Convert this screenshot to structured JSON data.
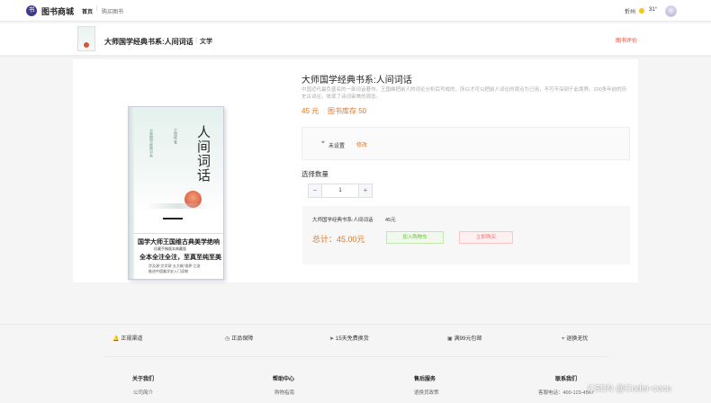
{
  "nav": {
    "logo_char": "书",
    "brand": "图书商城",
    "home": "首页",
    "separator": "|",
    "buy": "购买图书",
    "city": "忻州",
    "temperature": "31°"
  },
  "strip": {
    "title": "大师国学经典书系:人间词话",
    "separator": "|",
    "category": "文学",
    "review_link": "图书评价"
  },
  "cover": {
    "title": "人间词话",
    "side_text": "王国维 著",
    "side_text2": "大师国学经典书系",
    "band_line1": "国学大师王国维古典美学绝响",
    "band_line2": "珍藏手稿版本典藏版",
    "band_line3": "全本全注全注，至真至纯至美",
    "band_line4": "涉及源\"文学观\"五大概\"境界\"之说",
    "band_line5": "推进中国美学史入门读物"
  },
  "product": {
    "title": "大师国学经典书系:人间词话",
    "description": "中国近代最负盛名的一部词话著作。王国维把前人的词论分析后写成的，所以才可以把前人词论的观点为己用，不可不深刻于此境界。200多年前的历史古词论，体现了诗词审美的观念。",
    "price": "45 元",
    "stock": "图书库存 50"
  },
  "address": {
    "pin_icon": "location-pin-icon",
    "text": "未设置",
    "edit": "修改"
  },
  "quantity": {
    "label": "选择数量",
    "minus": "−",
    "value": "1",
    "plus": "+"
  },
  "summary": {
    "name": "大师国学经典书系:人间词话",
    "unit_price": "45元",
    "total": "总计：45.00元",
    "add_to_cart": "加入购物车",
    "buy_now": "立即购买"
  },
  "features": [
    {
      "icon": "bell-icon",
      "glyph": "🔔",
      "label": "正规渠道"
    },
    {
      "icon": "clock-icon",
      "glyph": "◷",
      "label": "正品保障"
    },
    {
      "icon": "send-icon",
      "glyph": "➤",
      "label": "15天免费换货"
    },
    {
      "icon": "wallet-icon",
      "glyph": "▣",
      "label": "满99元包邮"
    },
    {
      "icon": "location-icon",
      "glyph": "⌖",
      "label": "退换无忧"
    }
  ],
  "footer_columns": [
    {
      "title": "关于我们",
      "item": "公司简介"
    },
    {
      "title": "帮助中心",
      "item": "购物指南"
    },
    {
      "title": "售后服务",
      "item": "退换货政策"
    },
    {
      "title": "联系我们",
      "item": "客服电话：400-123-4567"
    }
  ],
  "watermark": "CSDN @Coder-coco",
  "colors": {
    "accent": "#e0782b",
    "brand": "#3f3a8f",
    "review": "#e64a3a",
    "cart": "#67c23a",
    "buy": "#f56c6c"
  }
}
